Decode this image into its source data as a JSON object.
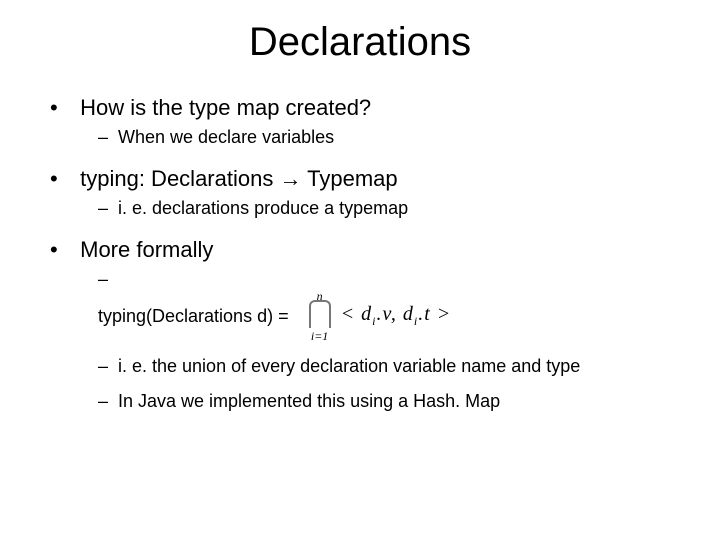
{
  "title": "Declarations",
  "bullets": {
    "b1": "How is the type map created?",
    "b1_sub1": "When we declare variables",
    "b2": "typing: Declarations → Typemap",
    "b2_sub1": "i. e. declarations produce a typemap",
    "b3": "More formally",
    "b3_sub1_prefix": "typing(Declarations d) =",
    "b3_sub2": "i. e. the union of every declaration variable name and type",
    "b3_sub3": "In Java we implemented this using a Hash. Map"
  },
  "formula": {
    "upper": "n",
    "lower": "i=1",
    "tuple_open": "<",
    "tuple_close": ">",
    "d": "d",
    "sub_i": "i",
    "dot_v": ".v,",
    "dot_t": ".t"
  }
}
